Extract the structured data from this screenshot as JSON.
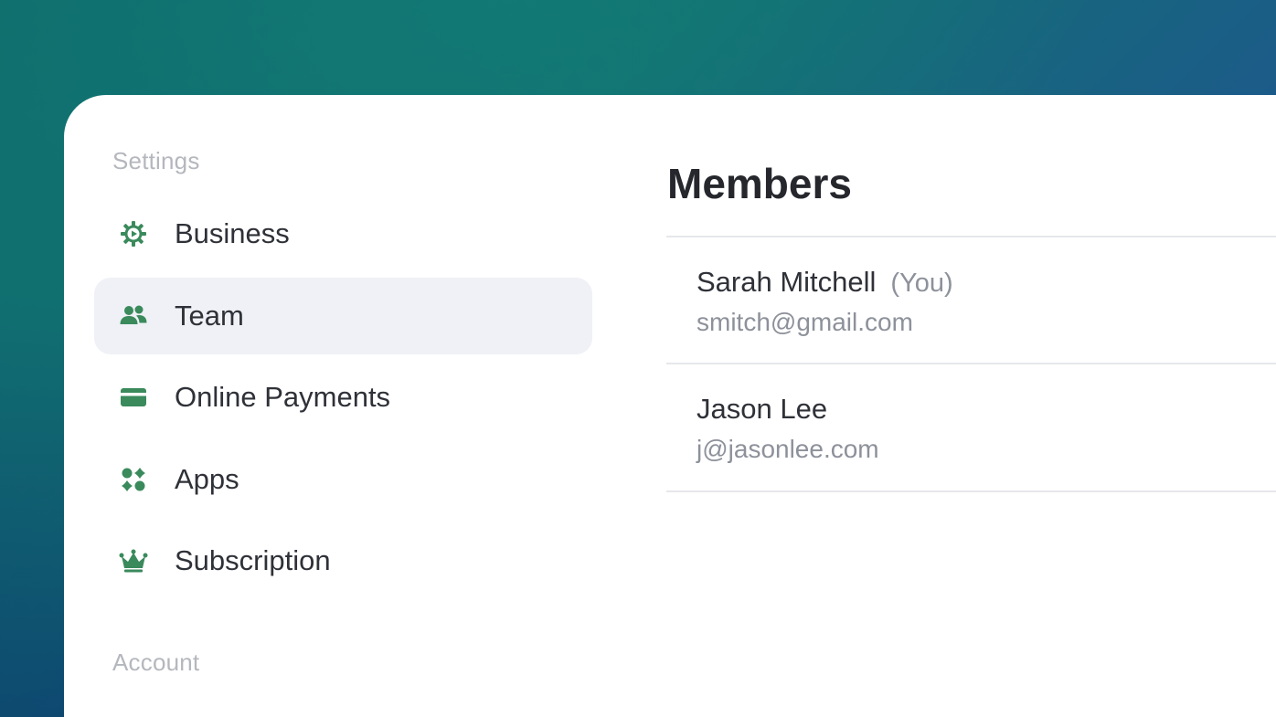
{
  "sidebar": {
    "settings_label": "Settings",
    "items": [
      {
        "label": "Business",
        "icon": "gear-icon",
        "active": false
      },
      {
        "label": "Team",
        "icon": "team-icon",
        "active": true
      },
      {
        "label": "Online Payments",
        "icon": "credit-card-icon",
        "active": false
      },
      {
        "label": "Apps",
        "icon": "apps-icon",
        "active": false
      },
      {
        "label": "Subscription",
        "icon": "crown-icon",
        "active": false
      }
    ],
    "account_label": "Account"
  },
  "main": {
    "title": "Members",
    "members": [
      {
        "name": "Sarah Mitchell",
        "tag": "(You)",
        "email": "smitch@gmail.com"
      },
      {
        "name": "Jason Lee",
        "tag": "",
        "email": "j@jasonlee.com"
      }
    ]
  },
  "colors": {
    "icon_green": "#3a8a5c",
    "active_bg": "#eff1f6",
    "background_teal": "#0f6f6e",
    "background_blue": "#233f96"
  }
}
